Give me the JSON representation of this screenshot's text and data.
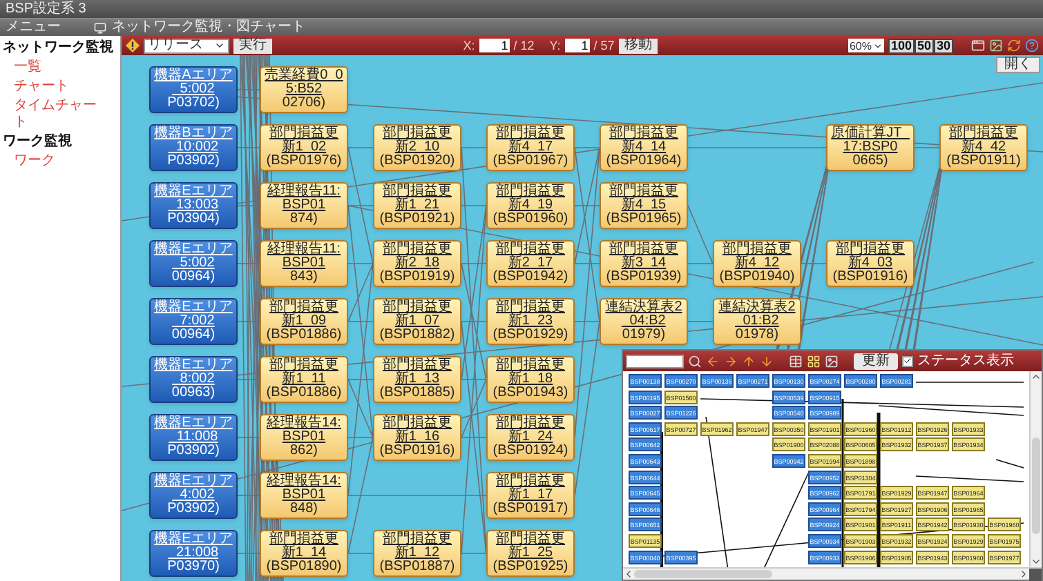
{
  "window": {
    "title": "BSP設定系 3"
  },
  "menu_bar": {
    "menu_label": "メニュー",
    "page_title": "ネットワーク監視・図チャート"
  },
  "sidebar": {
    "sections": [
      {
        "heading": "ネットワーク監視",
        "items": [
          {
            "label": "一覧"
          },
          {
            "label": "チャート"
          },
          {
            "label": "タイムチャート"
          }
        ]
      },
      {
        "heading": "ワーク監視",
        "items": [
          {
            "label": "ワーク"
          }
        ]
      }
    ]
  },
  "toolbar": {
    "filter_select": "リリース",
    "run_button": "実行",
    "x_label": "X:",
    "x_value": "1",
    "x_total": "/ 12",
    "y_label": "Y:",
    "y_value": "1",
    "y_total": "/ 57",
    "move_button": "移動",
    "zoom_select": "60%",
    "zoom_presets": [
      "100",
      "50",
      "30"
    ],
    "open_button": "開く"
  },
  "diagram": {
    "rows": [
      {
        "source": {
          "name": "機器Aエリア_5:002",
          "code": "P03702)"
        },
        "steps": [
          {
            "name": "売業経費0_05:B52",
            "code": "02706)"
          }
        ]
      },
      {
        "source": {
          "name": "機器Bエリア_10:002",
          "code": "P03902)"
        },
        "steps": [
          {
            "name": "部門損益更新1_02",
            "code": "(BSP01976)"
          },
          {
            "name": "部門損益更新2_10",
            "code": "(BSP01920)"
          },
          {
            "name": "部門損益更新4_17",
            "code": "(BSP01967)"
          },
          {
            "name": "部門損益更新4_14",
            "code": "(BSP01964)"
          },
          {
            "name": "原価計算JT_17:BSP0",
            "code": "0665)"
          },
          {
            "name": "部門損益更新4_42",
            "code": "(BSP01911)"
          }
        ]
      },
      {
        "source": {
          "name": "機器Eエリア_13:003",
          "code": "P03904)"
        },
        "steps": [
          {
            "name": "経理報告11:BSP01",
            "code": "874)"
          },
          {
            "name": "部門損益更新1_21",
            "code": "(BSP01921)"
          },
          {
            "name": "部門損益更新4_19",
            "code": "(BSP01960)"
          },
          {
            "name": "部門損益更新4_15",
            "code": "(BSP01965)"
          }
        ]
      },
      {
        "source": {
          "name": "機器Eエリア_5:002",
          "code": "00964)"
        },
        "steps": [
          {
            "name": "経理報告11:BSP01",
            "code": "843)"
          },
          {
            "name": "部門損益更新2_18",
            "code": "(BSP01919)"
          },
          {
            "name": "部門損益更新2_17",
            "code": "(BSP01942)"
          },
          {
            "name": "部門損益更新3_14",
            "code": "(BSP01939)"
          },
          {
            "name": "部門損益更新4_12",
            "code": "(BSP01940)"
          },
          {
            "name": "部門損益更新4_03",
            "code": "(BSP01916)"
          }
        ]
      },
      {
        "source": {
          "name": "機器Eエリア_7:002",
          "code": "00964)"
        },
        "steps": [
          {
            "name": "部門損益更新1_09",
            "code": "(BSP01886)"
          },
          {
            "name": "部門損益更新1_07",
            "code": "(BSP01882)"
          },
          {
            "name": "部門損益更新1_23",
            "code": "(BSP01929)"
          },
          {
            "name": "連結決算表2_04:B2",
            "code": "01979)"
          },
          {
            "name": "連結決算表2_01:B2",
            "code": "01978)"
          }
        ]
      },
      {
        "source": {
          "name": "機器Eエリア_8:002",
          "code": "00963)"
        },
        "steps": [
          {
            "name": "部門損益更新1_11",
            "code": "(BSP01886)"
          },
          {
            "name": "部門損益更新1_13",
            "code": "(BSP01885)"
          },
          {
            "name": "部門損益更新1_18",
            "code": "(BSP01943)"
          }
        ]
      },
      {
        "source": {
          "name": "機器Eエリア_11:008",
          "code": "P03902)"
        },
        "steps": [
          {
            "name": "経理報告14:BSP01",
            "code": "862)"
          },
          {
            "name": "部門損益更新1_16",
            "code": "(BSP01916)"
          },
          {
            "name": "部門損益更新1_24",
            "code": "(BSP01924)"
          }
        ]
      },
      {
        "source": {
          "name": "機器Eエリア_4:002",
          "code": "P03902)"
        },
        "steps": [
          {
            "name": "経理報告14:BSP01",
            "code": "848)"
          },
          {
            "name": "部門損益更新1_17",
            "code": "(BSP01917)"
          }
        ]
      },
      {
        "source": {
          "name": "機器Eエリア_21:008",
          "code": "P03970)"
        },
        "steps": [
          {
            "name": "部門損益更新1_14",
            "code": "(BSP01890)"
          },
          {
            "name": "部門損益更新1_12",
            "code": "(BSP01887)"
          },
          {
            "name": "部門損益更新1_25",
            "code": "(BSP01925)"
          }
        ]
      }
    ]
  },
  "overview": {
    "refresh_button": "更新",
    "status_toggle": {
      "label": "ステータス表示",
      "checked": true
    },
    "rows": [
      [
        {
          "label": "BSP00138",
          "kind": "source"
        },
        {
          "label": "BSP00270",
          "kind": "source"
        },
        {
          "label": "BSP00136",
          "kind": "source"
        },
        {
          "label": "BSP00271",
          "kind": "source"
        },
        {
          "label": "BSP00130",
          "kind": "source"
        },
        {
          "label": "BSP00274",
          "kind": "source"
        },
        {
          "label": "BSP00280",
          "kind": "source"
        },
        {
          "label": "BSP00281",
          "kind": "source"
        }
      ],
      [
        {
          "label": "BSP00195",
          "kind": "source"
        },
        {
          "label": "BSP01560",
          "kind": "job"
        },
        null,
        null,
        {
          "label": "BSP00539",
          "kind": "source"
        },
        {
          "label": "BSP00915",
          "kind": "source"
        }
      ],
      [
        {
          "label": "BSP00027",
          "kind": "source"
        },
        {
          "label": "BSP01226",
          "kind": "source"
        },
        null,
        null,
        {
          "label": "BSP00540",
          "kind": "source"
        },
        {
          "label": "BSP00989",
          "kind": "source"
        }
      ],
      [
        {
          "label": "BSP00617",
          "kind": "source"
        },
        {
          "label": "BSP00727",
          "kind": "job"
        },
        {
          "label": "BSP01962",
          "kind": "job"
        },
        {
          "label": "BSP01947",
          "kind": "job"
        },
        {
          "label": "BSP00350",
          "kind": "job"
        },
        {
          "label": "BSP01901",
          "kind": "job"
        },
        {
          "label": "BSP01960",
          "kind": "job"
        },
        {
          "label": "BSP01912",
          "kind": "job"
        },
        {
          "label": "BSP01926",
          "kind": "job"
        },
        {
          "label": "BSP01933",
          "kind": "job"
        }
      ],
      [
        {
          "label": "BSP00642",
          "kind": "source"
        },
        null,
        null,
        null,
        {
          "label": "BSP01900",
          "kind": "job"
        },
        {
          "label": "BSP02088",
          "kind": "job"
        },
        {
          "label": "BSP00605",
          "kind": "job"
        },
        {
          "label": "BSP01932",
          "kind": "job"
        },
        {
          "label": "BSP01937",
          "kind": "job"
        },
        {
          "label": "BSP01934",
          "kind": "job"
        }
      ],
      [
        {
          "label": "BSP00643",
          "kind": "source"
        },
        null,
        null,
        null,
        {
          "label": "BSP00942",
          "kind": "source"
        },
        {
          "label": "BSP01994",
          "kind": "job"
        },
        {
          "label": "BSP01898",
          "kind": "job"
        }
      ],
      [
        {
          "label": "BSP00644",
          "kind": "source"
        },
        null,
        null,
        null,
        null,
        {
          "label": "BSP00952",
          "kind": "source"
        },
        {
          "label": "BSP01304",
          "kind": "job"
        }
      ],
      [
        {
          "label": "BSP00645",
          "kind": "source"
        },
        null,
        null,
        null,
        null,
        {
          "label": "BSP00962",
          "kind": "source"
        },
        {
          "label": "BSP01791",
          "kind": "job"
        },
        {
          "label": "BSP01929",
          "kind": "job"
        },
        {
          "label": "BSP01947",
          "kind": "job"
        },
        {
          "label": "BSP01964",
          "kind": "job"
        }
      ],
      [
        {
          "label": "BSP00646",
          "kind": "source"
        },
        null,
        null,
        null,
        null,
        {
          "label": "BSP00964",
          "kind": "source"
        },
        {
          "label": "BSP01794",
          "kind": "job"
        },
        {
          "label": "BSP01927",
          "kind": "job"
        },
        {
          "label": "BSP01906",
          "kind": "job"
        },
        {
          "label": "BSP01965",
          "kind": "job"
        }
      ],
      [
        {
          "label": "BSP00651",
          "kind": "source"
        },
        null,
        null,
        null,
        null,
        {
          "label": "BSP00924",
          "kind": "source"
        },
        {
          "label": "BSP01901",
          "kind": "job"
        },
        {
          "label": "BSP01911",
          "kind": "job"
        },
        {
          "label": "BSP01942",
          "kind": "job"
        },
        {
          "label": "BSP01930",
          "kind": "job"
        },
        {
          "label": "BSP01960",
          "kind": "job"
        }
      ],
      [
        {
          "label": "BSP01135",
          "kind": "job"
        },
        null,
        null,
        null,
        null,
        {
          "label": "BSP00934",
          "kind": "source"
        },
        {
          "label": "BSP01903",
          "kind": "job"
        },
        {
          "label": "BSP01932",
          "kind": "job"
        },
        {
          "label": "BSP01924",
          "kind": "job"
        },
        {
          "label": "BSP01929",
          "kind": "job"
        },
        {
          "label": "BSP01975",
          "kind": "job"
        }
      ],
      [
        {
          "label": "BSP00040",
          "kind": "source"
        },
        {
          "label": "BSP00395",
          "kind": "source"
        },
        null,
        null,
        null,
        {
          "label": "BSP00933",
          "kind": "source"
        },
        {
          "label": "BSP01906",
          "kind": "job"
        },
        {
          "label": "BSP01905",
          "kind": "job"
        },
        {
          "label": "BSP01943",
          "kind": "job"
        },
        {
          "label": "BSP01960",
          "kind": "job"
        },
        {
          "label": "BSP01977",
          "kind": "job"
        }
      ]
    ]
  }
}
